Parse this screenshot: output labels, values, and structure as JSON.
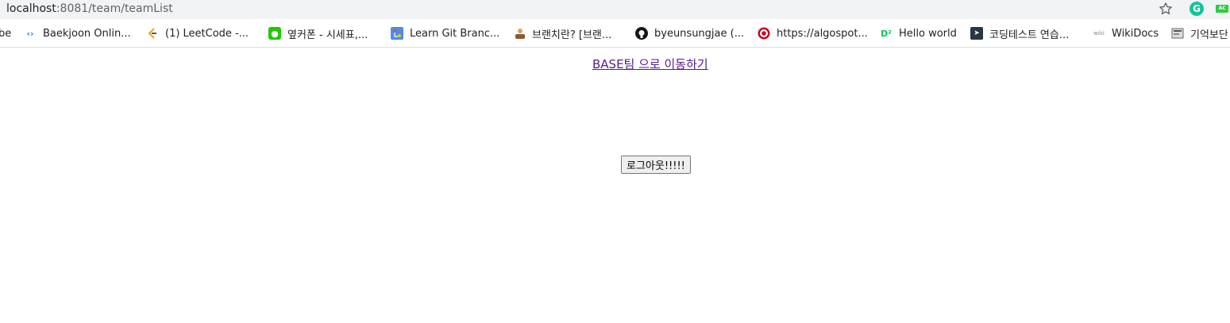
{
  "browser": {
    "address": {
      "host": "localhost",
      "path": ":8081/team/teamList"
    }
  },
  "bookmarks": [
    {
      "label": "be",
      "icon": "youtube-icon"
    },
    {
      "label": "Baekjoon Onlin...",
      "icon": "code-brackets-icon"
    },
    {
      "label": "(1) LeetCode -...",
      "icon": "leetcode-icon"
    },
    {
      "label": "옆커폰 - 시세표,...",
      "icon": "green-square-icon"
    },
    {
      "label": "Learn Git Branc...",
      "icon": "git-tree-icon"
    },
    {
      "label": "브랜치란? [브랜...",
      "icon": "person-icon"
    },
    {
      "label": "byeunsungjae (...",
      "icon": "github-icon"
    },
    {
      "label": "https://algospot...",
      "icon": "target-icon"
    },
    {
      "label": "Hello world",
      "icon": "d2-icon"
    },
    {
      "label": "코딩테스트 연습...",
      "icon": "arrow-badge-icon"
    },
    {
      "label": "WikiDocs",
      "icon": "wiki-icon"
    },
    {
      "label": "기억보단",
      "icon": "document-icon"
    }
  ],
  "extensions": {
    "grammarly": "G",
    "ac": "AC"
  },
  "page": {
    "team_link": "BASE팀 으로 이동하기",
    "logout_button": "로그아웃!!!!!"
  },
  "colors": {
    "link": "#551a8b",
    "grammarly": "#15c39a",
    "ac": "#2ecc40"
  }
}
